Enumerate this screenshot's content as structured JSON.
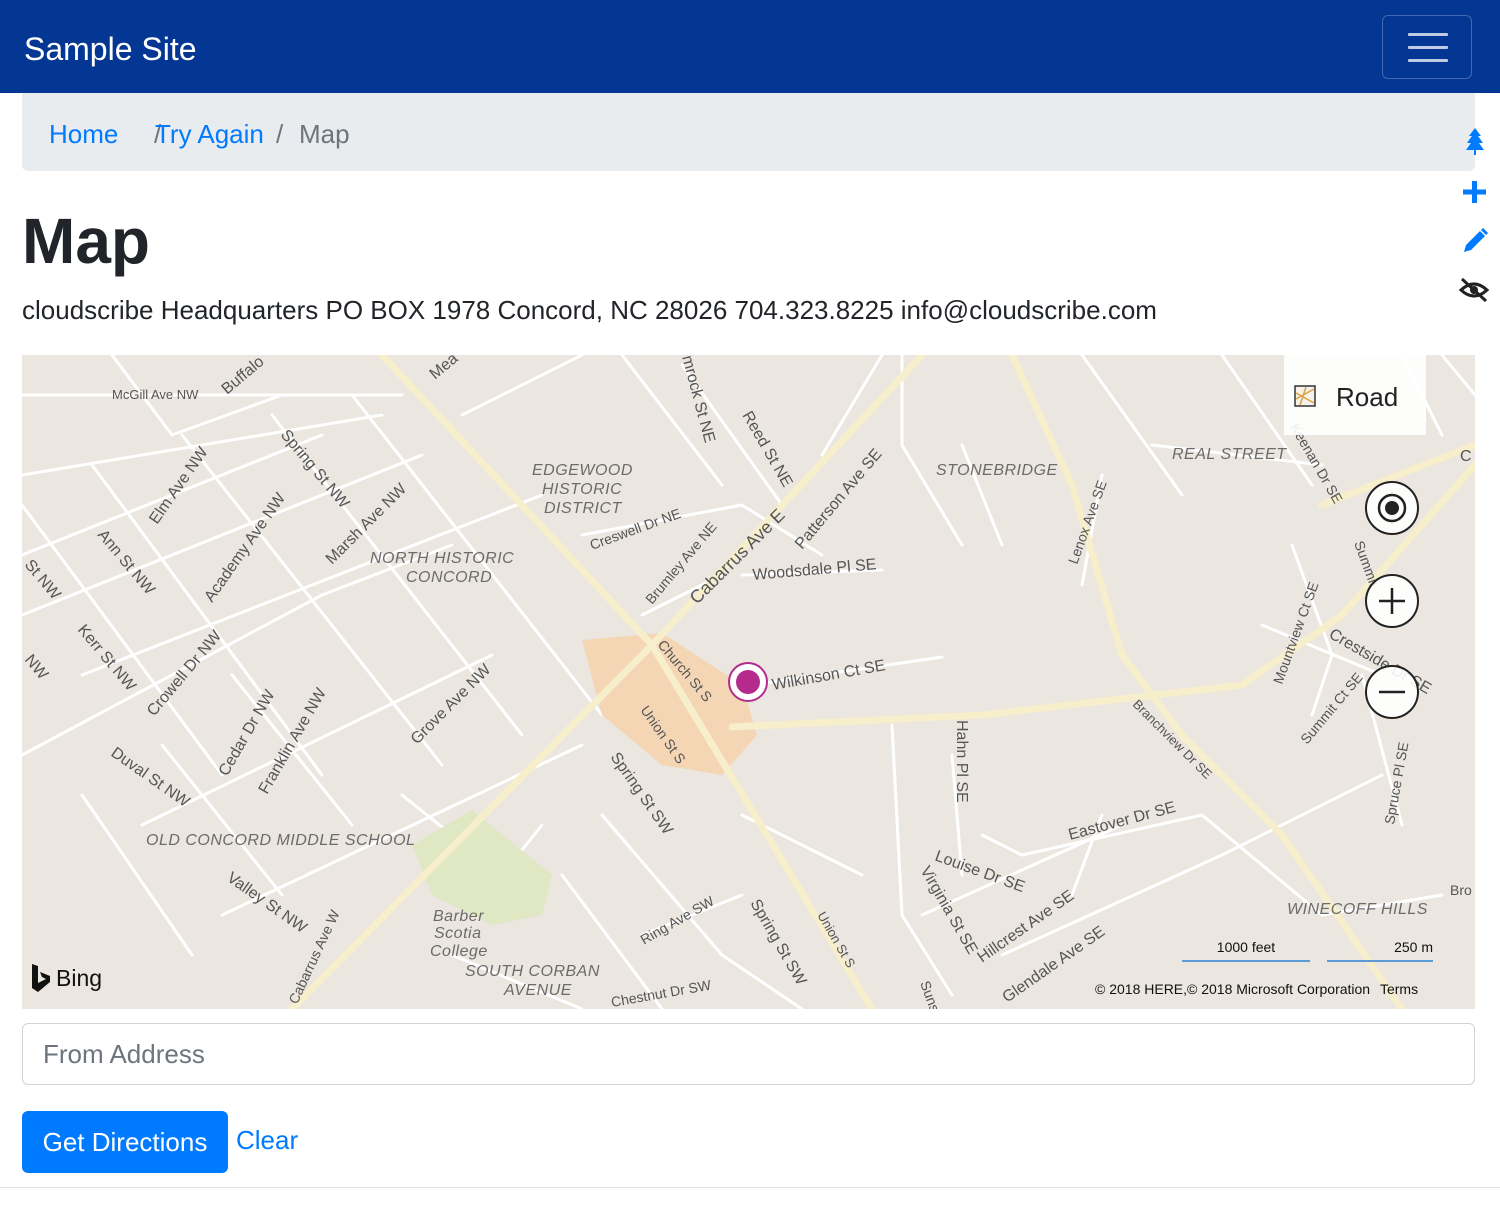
{
  "navbar": {
    "brand": "Sample Site",
    "toggler_icon": "hamburger-icon"
  },
  "breadcrumb": {
    "items": [
      "Home",
      "Try Again"
    ],
    "active": "Map",
    "separator": "/"
  },
  "page": {
    "title": "Map",
    "address": "cloudscribe Headquarters PO BOX 1978 Concord, NC 28026  704.323.8225 info@cloudscribe.com"
  },
  "side_tools": [
    "tree-icon",
    "plus-icon",
    "pencil-icon",
    "eye-slash-icon"
  ],
  "map": {
    "provider": "Bing",
    "map_type_label": "Road",
    "scale_feet": "1000 feet",
    "scale_meters": "250 m",
    "copyright": "© 2018 HERE,© 2018 Microsoft Corporation",
    "terms": "Terms",
    "districts": [
      "EDGEWOOD",
      "HISTORIC",
      "DISTRICT",
      "NORTH HISTORIC",
      "CONCORD",
      "STONEBRIDGE",
      "REAL STREET",
      "OLD CONCORD MIDDLE SCHOOL",
      "SOUTH CORBAN",
      "AVENUE",
      "WINECOFF HILLS",
      "Barber",
      "Scotia",
      "College"
    ],
    "streets": [
      "McGill Ave NW",
      "Buffalo",
      "Mea",
      "mrock St NE",
      "Reed St NE",
      "Spring St NW",
      "Elm Ave NW",
      "Academy Ave NW",
      "Marsh Ave NW",
      "Ann St NW",
      "St NW",
      "Kerr St NW",
      "NW",
      "Crowell Dr NW",
      "Cedar Dr NW",
      "Franklin Ave NW",
      "Grove Ave NW",
      "Duval St NW",
      "Valley St NW",
      "Cabarrus Ave W",
      "Creswell Dr NE",
      "Brumley Ave NE",
      "Cabarrus Ave E",
      "Patterson Ave SE",
      "Woodsdale Pl SE",
      "Church St S",
      "Union St S",
      "Spring St SW",
      "Wilkinson Ct SE",
      "Hahn Pl SE",
      "Lenox Ave SE",
      "Branchview Dr SE",
      "Mountview Ct SE",
      "Summit Ct SE",
      "Crestside Dr SE",
      "Spruce Pl SE",
      "Eastover Dr SE",
      "Louise Dr SE",
      "Virginia St SE",
      "Hillcrest Ave SE",
      "Glendale Ave SE",
      "Ring Ave SW",
      "Spring St SW",
      "Union St S",
      "Chestnut Dr SW",
      "Suns",
      "Keenan Dr SE",
      "Summit",
      "Bro",
      "C"
    ]
  },
  "directions": {
    "from_placeholder": "From Address",
    "submit_label": "Get Directions",
    "clear_label": "Clear"
  }
}
